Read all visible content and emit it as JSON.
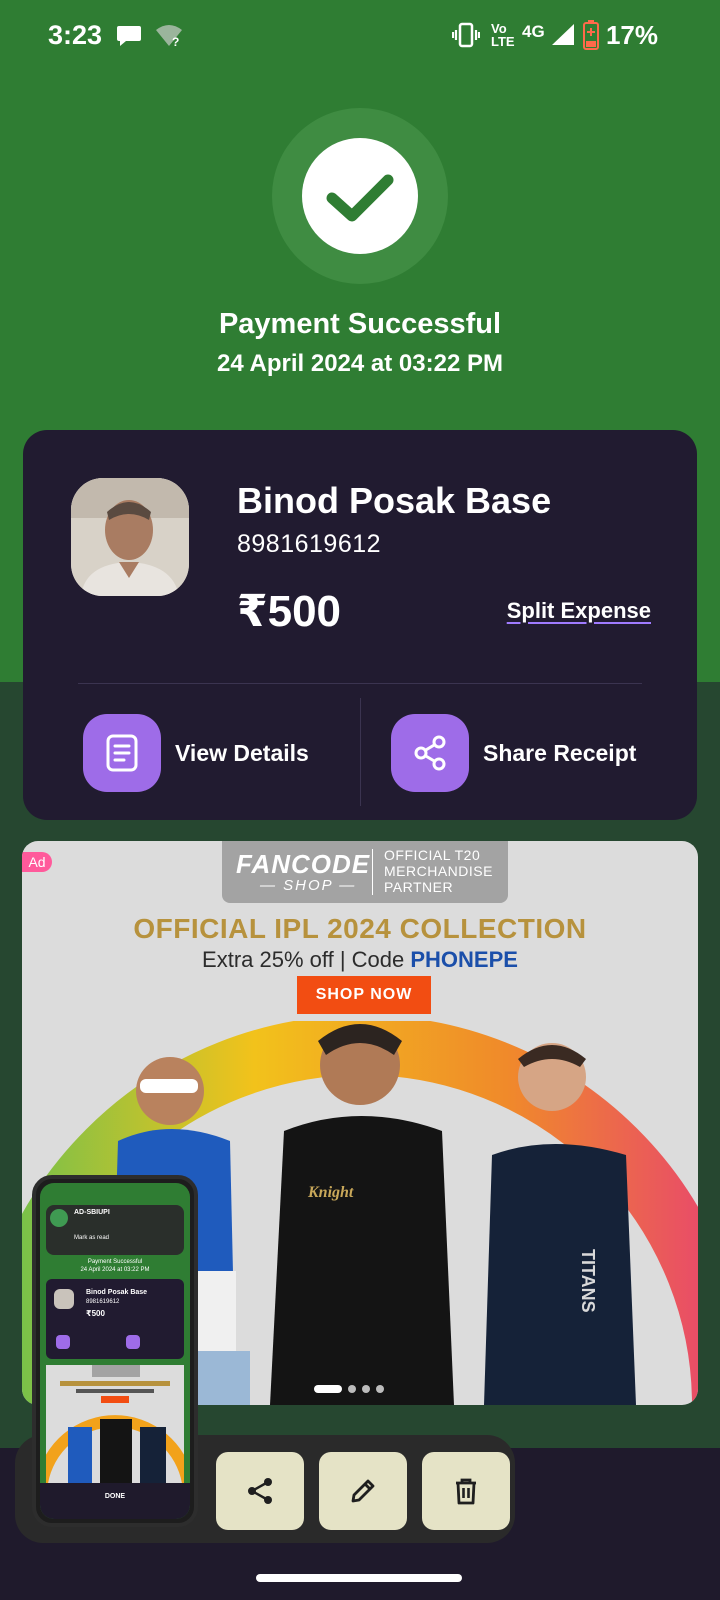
{
  "status_bar": {
    "time": "3:23",
    "network": "4G",
    "volte": "Vo LTE",
    "battery": "17%"
  },
  "success": {
    "title": "Payment Successful",
    "date": "24 April 2024 at 03:22 PM"
  },
  "payment_card": {
    "payee_name": "Binod Posak Base",
    "payee_phone": "8981619612",
    "amount": "₹500",
    "split_label": "Split Expense",
    "actions": [
      {
        "label": "View Details",
        "icon": "receipt-icon"
      },
      {
        "label": "Share Receipt",
        "icon": "share-icon"
      }
    ]
  },
  "ad": {
    "badge": "Ad",
    "brand": "FANCODE",
    "brand_sub": "— SHOP —",
    "partner": "OFFICIAL T20\nMERCHANDISE\nPARTNER",
    "headline": "OFFICIAL IPL 2024 COLLECTION",
    "offer_prefix": "Extra 25% off | Code ",
    "offer_code": "PHONEPE",
    "cta": "SHOP NOW",
    "carousel_active_index": 0,
    "carousel_count": 4
  },
  "screenshot_preview": {
    "notification_title": "AD-SBIUPI",
    "notification_action": "Mark as read",
    "mini_title": "Payment Successful",
    "mini_date": "24 April 2024 at 03:22 PM",
    "mini_name": "Binod Posak Base",
    "mini_phone": "8981619612",
    "mini_amount": "₹500",
    "done_label": "DONE",
    "tools": [
      "share-icon",
      "edit-icon",
      "delete-icon"
    ]
  },
  "colors": {
    "success_green": "#2f7d33",
    "card_bg": "#211b30",
    "accent_purple": "#9e6ce8",
    "ad_cta": "#f24d12"
  }
}
